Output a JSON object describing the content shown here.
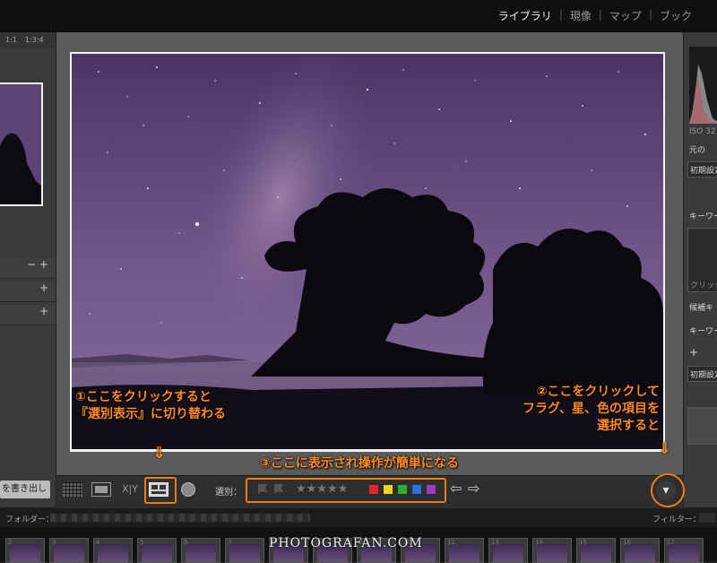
{
  "modules": {
    "library": "ライブラリ",
    "develop": "現像",
    "map": "マップ",
    "book": "ブック",
    "separator": "|"
  },
  "left_panel": {
    "zoom_1_1": "1:1",
    "zoom_ratio": "1:3:4",
    "row_controls": "− +",
    "row_plus": "+",
    "write_out": "を書き出し"
  },
  "right_panel": {
    "iso": "ISO 32",
    "original": "元の",
    "initial_preset": "初期設定",
    "keyword": "キーワー",
    "click": "クリック",
    "suggest_keyword": "候補キ",
    "keyword2": "キーワー",
    "plus": "+",
    "initial_preset2": "初期設定"
  },
  "toolbar": {
    "select_label": "選別：",
    "stars": "★★★★★",
    "color_labels": [
      "#e8242c",
      "#e8d81c",
      "#28b034",
      "#2a70e0",
      "#9a3ad0"
    ],
    "arrow_left": "⇦",
    "arrow_right": "⇨",
    "xy_label": "X|Y",
    "dropdown": "▾"
  },
  "folderbar": {
    "folder_label": "フォルダー：",
    "filter_label": "フィルター："
  },
  "filmstrip": {
    "numbers": [
      "2",
      "3",
      "4",
      "5",
      "6",
      "7",
      "8",
      "9",
      "10",
      "11",
      "12",
      "13",
      "14",
      "15",
      "16",
      "17"
    ],
    "watermark": "PHOTOGRAFAN.COM"
  },
  "annotations": {
    "a1_line1": "①ここをクリックすると",
    "a1_line2": "『選別表示』に切り替わる",
    "a2_line1": "②ここをクリックして",
    "a2_line2": "フラグ、星、色の項目を",
    "a2_line3": "選択すると",
    "a3": "③ここに表示され操作が簡単になる",
    "down_arrow": "⇓"
  }
}
